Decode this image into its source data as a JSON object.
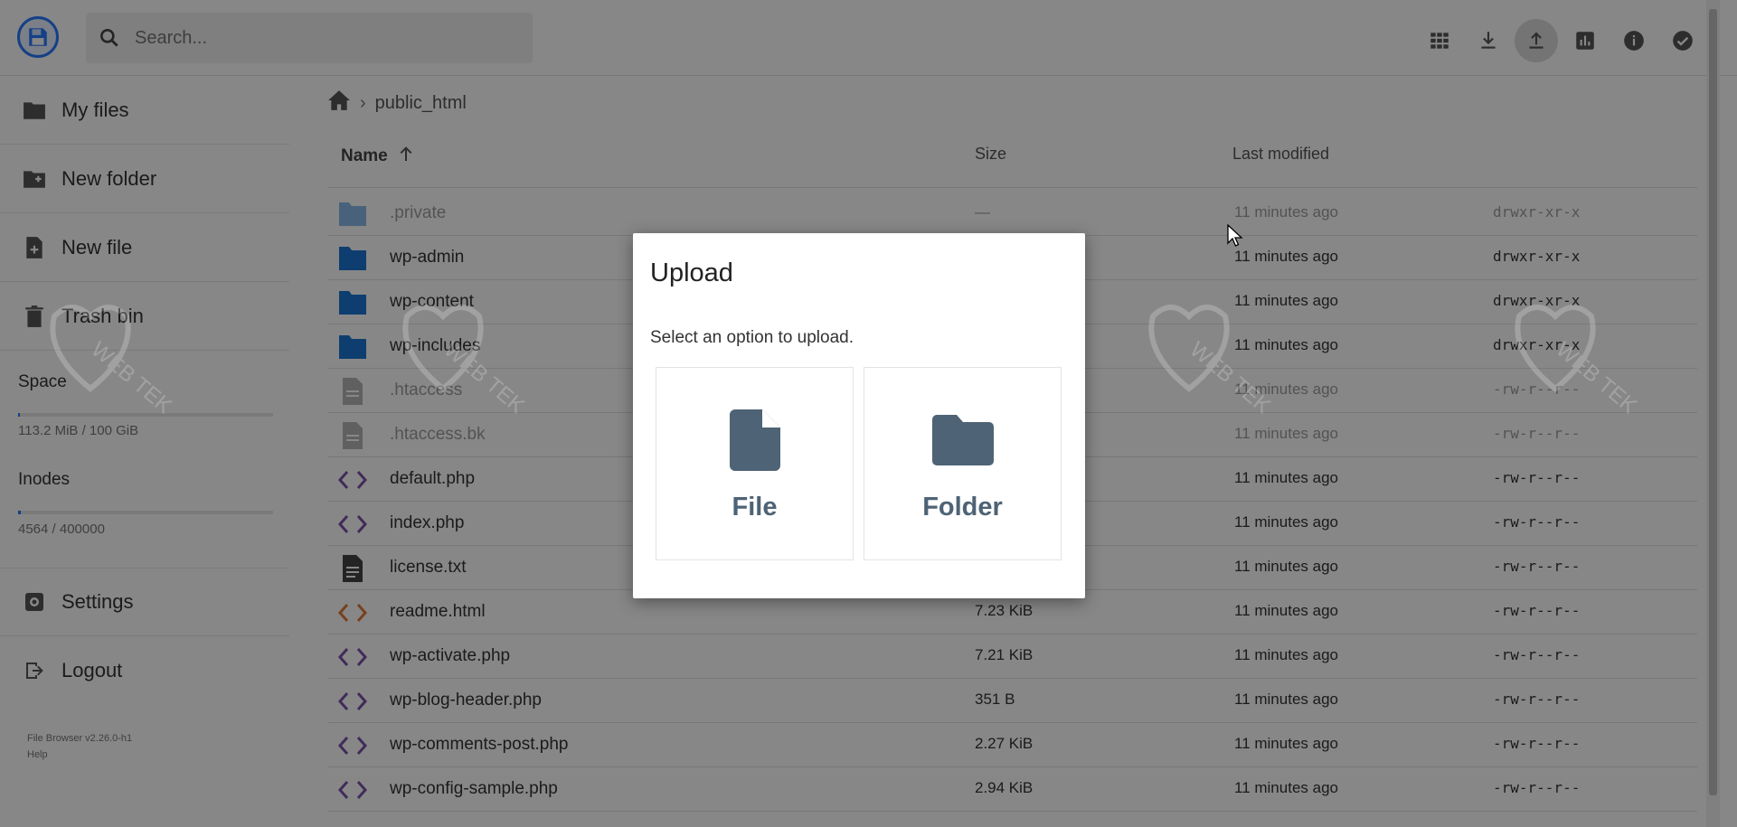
{
  "app": {
    "logo_icon": "floppy-disk-icon"
  },
  "search": {
    "placeholder": "Search..."
  },
  "toolbar": {
    "buttons": [
      {
        "name": "grid-view",
        "icon": "grid-icon"
      },
      {
        "name": "download",
        "icon": "download-icon"
      },
      {
        "name": "upload",
        "icon": "upload-icon",
        "active": true
      },
      {
        "name": "shell",
        "icon": "chart-icon"
      },
      {
        "name": "info",
        "icon": "info-icon"
      },
      {
        "name": "select",
        "icon": "check-circle-icon"
      }
    ]
  },
  "sidebar": {
    "items": [
      {
        "label": "My files",
        "icon": "folder-icon"
      },
      {
        "label": "New folder",
        "icon": "new-folder-icon"
      },
      {
        "label": "New file",
        "icon": "new-file-icon"
      },
      {
        "label": "Trash bin",
        "icon": "trash-icon"
      }
    ],
    "space": {
      "label": "Space",
      "value": "113.2 MiB / 100 GiB",
      "fraction": 0.001
    },
    "inodes": {
      "label": "Inodes",
      "value": "4564 / 400000",
      "fraction": 0.011
    },
    "settings_label": "Settings",
    "logout_label": "Logout",
    "version": "File Browser v2.26.0-h1",
    "help": "Help"
  },
  "breadcrumb": {
    "current": "public_html"
  },
  "table": {
    "headers": {
      "name": "Name",
      "size": "Size",
      "modified": "Last modified"
    },
    "rows": [
      {
        "name": ".private",
        "size": "—",
        "modified": "11 minutes ago",
        "perm": "drwxr-xr-x",
        "type": "folder",
        "dim": true
      },
      {
        "name": "wp-admin",
        "size": "",
        "modified": "11 minutes ago",
        "perm": "drwxr-xr-x",
        "type": "folder"
      },
      {
        "name": "wp-content",
        "size": "",
        "modified": "11 minutes ago",
        "perm": "drwxr-xr-x",
        "type": "folder"
      },
      {
        "name": "wp-includes",
        "size": "",
        "modified": "11 minutes ago",
        "perm": "drwxr-xr-x",
        "type": "folder"
      },
      {
        "name": ".htaccess",
        "size": "",
        "modified": "11 minutes ago",
        "perm": "-rw-r--r--",
        "type": "file",
        "dim": true
      },
      {
        "name": ".htaccess.bk",
        "size": "",
        "modified": "11 minutes ago",
        "perm": "-rw-r--r--",
        "type": "file",
        "dim": true
      },
      {
        "name": "default.php",
        "size": "",
        "modified": "11 minutes ago",
        "perm": "-rw-r--r--",
        "type": "code"
      },
      {
        "name": "index.php",
        "size": "",
        "modified": "11 minutes ago",
        "perm": "-rw-r--r--",
        "type": "code"
      },
      {
        "name": "license.txt",
        "size": "",
        "modified": "11 minutes ago",
        "perm": "-rw-r--r--",
        "type": "text"
      },
      {
        "name": "readme.html",
        "size": "7.23 KiB",
        "modified": "11 minutes ago",
        "perm": "-rw-r--r--",
        "type": "html"
      },
      {
        "name": "wp-activate.php",
        "size": "7.21 KiB",
        "modified": "11 minutes ago",
        "perm": "-rw-r--r--",
        "type": "code"
      },
      {
        "name": "wp-blog-header.php",
        "size": "351 B",
        "modified": "11 minutes ago",
        "perm": "-rw-r--r--",
        "type": "code"
      },
      {
        "name": "wp-comments-post.php",
        "size": "2.27 KiB",
        "modified": "11 minutes ago",
        "perm": "-rw-r--r--",
        "type": "code"
      },
      {
        "name": "wp-config-sample.php",
        "size": "2.94 KiB",
        "modified": "11 minutes ago",
        "perm": "-rw-r--r--",
        "type": "code"
      }
    ]
  },
  "modal": {
    "title": "Upload",
    "text": "Select an option to upload.",
    "options": [
      {
        "label": "File",
        "icon": "file-icon"
      },
      {
        "label": "Folder",
        "icon": "folder-icon"
      }
    ]
  },
  "watermark": {
    "text": "WEB TEK"
  },
  "colors": {
    "accent": "#2979ff",
    "folder": "#1976d2",
    "code": "#7b52ab",
    "html": "#e07b39",
    "option_icon": "#4e6375"
  }
}
